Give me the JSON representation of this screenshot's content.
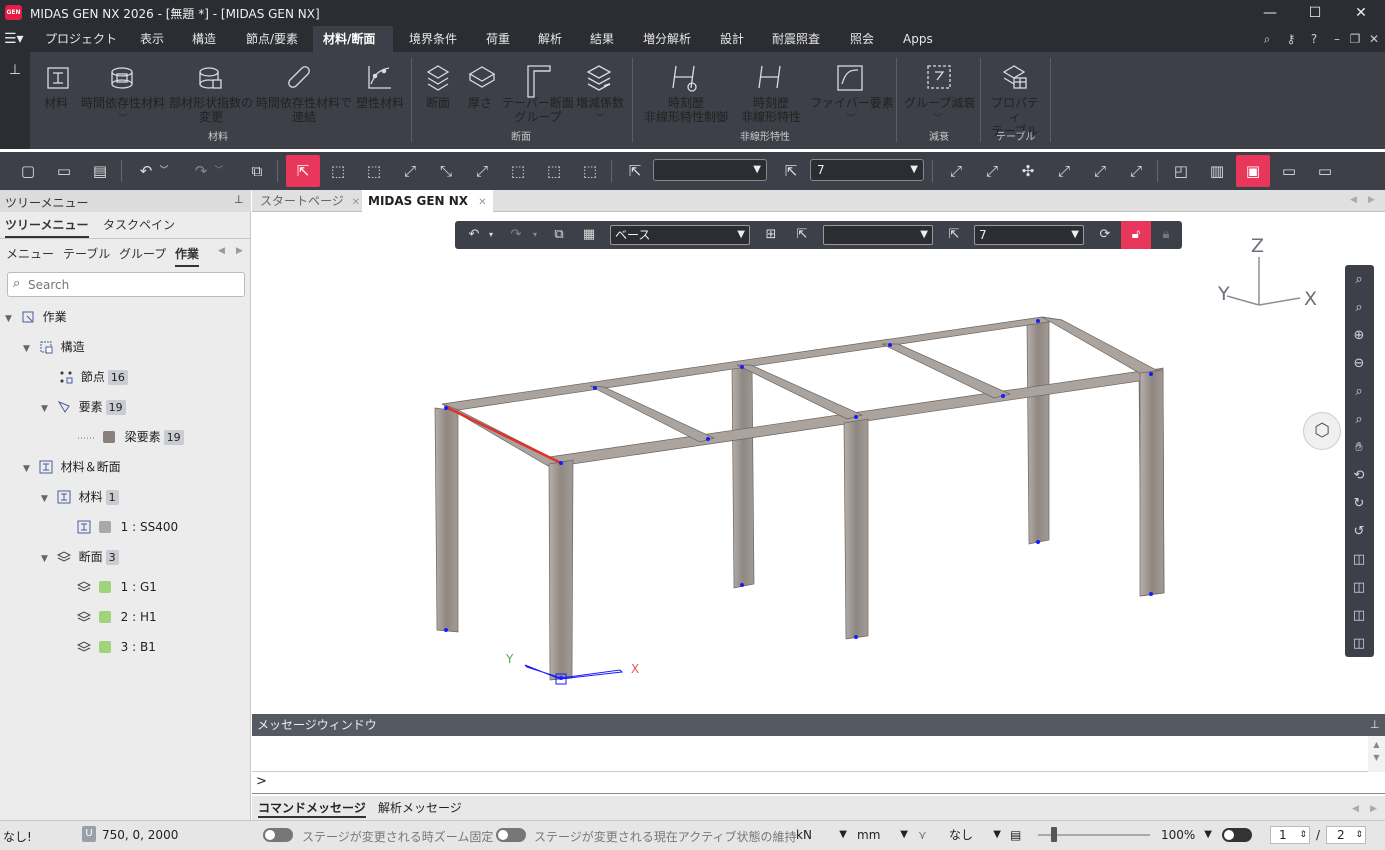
{
  "app": {
    "title": "MIDAS GEN NX 2026 - [無題 *] - [MIDAS GEN NX]",
    "logo_text": "GEN"
  },
  "menu": {
    "items": [
      "プロジェクト",
      "表示",
      "構造",
      "節点/要素",
      "材料/断面",
      "境界条件",
      "荷重",
      "解析",
      "結果",
      "増分解析",
      "設計",
      "耐震照査",
      "照会",
      "Apps"
    ],
    "active": "材料/断面"
  },
  "ribbon": {
    "buttons": [
      {
        "label": "材料",
        "icon": "material-icon"
      },
      {
        "label": "時間依存性材料",
        "icon": "time-material-icon",
        "dropdown": true
      },
      {
        "label": "部材形状指数の\n変更",
        "icon": "shape-index-icon"
      },
      {
        "label": "時間依存性材料で\n連結",
        "icon": "link-icon"
      },
      {
        "label": "塑性材料",
        "icon": "plastic-material-icon"
      },
      {
        "label": "断面",
        "icon": "section-icon"
      },
      {
        "label": "厚さ",
        "icon": "thickness-icon"
      },
      {
        "label": "テーパー断面\nグループ",
        "icon": "tapered-section-icon"
      },
      {
        "label": "増減係数",
        "icon": "scale-factor-icon",
        "dropdown": true
      },
      {
        "label": "時刻歴\n非線形特性制御",
        "icon": "time-history-control-icon",
        "dropdown": true
      },
      {
        "label": "時刻歴\n非線形特性",
        "icon": "time-history-property-icon",
        "dropdown": true
      },
      {
        "label": "ファイバー要素",
        "icon": "fiber-element-icon",
        "dropdown": true
      },
      {
        "label": "グループ減衰",
        "icon": "group-damping-icon",
        "dropdown": true
      },
      {
        "label": "プロパティ\nテーブル",
        "icon": "property-table-icon",
        "dropdown": true
      }
    ],
    "groups": [
      "材料",
      "断面",
      "非線形特性",
      "減衰",
      "テーブル"
    ]
  },
  "toolbar": {
    "select1_value": "",
    "select2_value": "7"
  },
  "left_panel": {
    "header": "ツリーメニュー",
    "tabs": [
      "ツリーメニュー",
      "タスクペイン"
    ],
    "subtabs": [
      "メニュー",
      "テーブル",
      "グループ",
      "作業"
    ],
    "search_placeholder": "Search",
    "tree": [
      {
        "label": "作業",
        "level": 0,
        "icon": "work-icon"
      },
      {
        "label": "構造",
        "level": 1,
        "icon": "structure-icon"
      },
      {
        "label": "節点",
        "level": 2,
        "count": "16",
        "icon": "node-icon"
      },
      {
        "label": "要素",
        "level": 2,
        "count": "19",
        "icon": "element-icon"
      },
      {
        "label": "梁要素",
        "level": 3,
        "count": "19",
        "icon": "beam-element-icon",
        "swatch": "#8a7f7b"
      },
      {
        "label": "材料＆断面",
        "level": 1,
        "icon": "material-section-icon"
      },
      {
        "label": "材料",
        "level": 2,
        "count": "1",
        "icon": "material-icon"
      },
      {
        "label": "1 : SS400",
        "level": 3,
        "icon": "material-item-icon",
        "swatch": "#a9a9a9"
      },
      {
        "label": "断面",
        "level": 2,
        "count": "3",
        "icon": "section-icon"
      },
      {
        "label": "1 : G1",
        "level": 3,
        "icon": "section-item-icon",
        "swatch": "#9fd47a"
      },
      {
        "label": "2 : H1",
        "level": 3,
        "icon": "section-item-icon",
        "swatch": "#9fd47a"
      },
      {
        "label": "3 : B1",
        "level": 3,
        "icon": "section-item-icon",
        "swatch": "#9fd47a"
      }
    ]
  },
  "doc_tabs": [
    "スタートページ",
    "MIDAS GEN NX"
  ],
  "viewport_toolbar": {
    "stage_value": "ベース",
    "select_mid_value": "",
    "select_right_value": "7"
  },
  "axes": {
    "global": [
      "Z",
      "Y",
      "X"
    ],
    "local": [
      "Y",
      "X"
    ]
  },
  "message_window": {
    "title": "メッセージウィンドウ",
    "prompt": ">",
    "tabs": [
      "コマンドメッセージ",
      "解析メッセージ"
    ]
  },
  "status": {
    "left": "なし!",
    "coord_badge": "U",
    "coords": "750, 0, 2000",
    "toggle1_label": "ステージが変更される時ズーム固定",
    "toggle2_label": "ステージが変更される現在アクティブ状態の維持",
    "force_unit": "kN",
    "length_unit": "mm",
    "filter": "なし",
    "zoom": "100%",
    "page_current": "1",
    "page_sep": "/",
    "page_total": "2"
  },
  "colors": {
    "accent": "#e8375a",
    "dark_bar": "#2b2d33",
    "ribbon": "#3d4048",
    "beam": "#9d958f",
    "selected_beam": "#e0312b",
    "node": "#1a1aff"
  }
}
